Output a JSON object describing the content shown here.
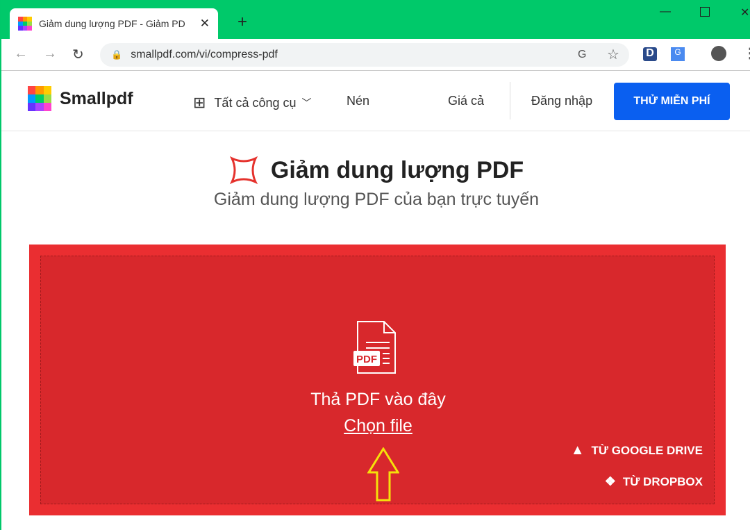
{
  "browser": {
    "tab_title": "Giảm dung lượng PDF - Giảm PD",
    "url": "smallpdf.com/vi/compress-pdf"
  },
  "header": {
    "logo": "Smallpdf",
    "all_tools": "Tất cả công cụ",
    "compress": "Nén",
    "pricing": "Giá cả",
    "login": "Đăng nhập",
    "try_free": "THỬ MIỄN PHÍ"
  },
  "hero": {
    "title": "Giảm dung lượng PDF",
    "subtitle": "Giảm dung lượng PDF của bạn trực tuyến"
  },
  "dropzone": {
    "pdf_badge": "PDF",
    "drop_text": "Thả PDF vào đây",
    "choose_file": "Chọn file",
    "google_drive": "TỪ GOOGLE DRIVE",
    "dropbox": "TỪ DROPBOX"
  },
  "colors": {
    "titlebar": "#00c96a",
    "cta": "#0a5ff0",
    "dropzone": "#d8282c",
    "arrow": "#f5e10a"
  }
}
